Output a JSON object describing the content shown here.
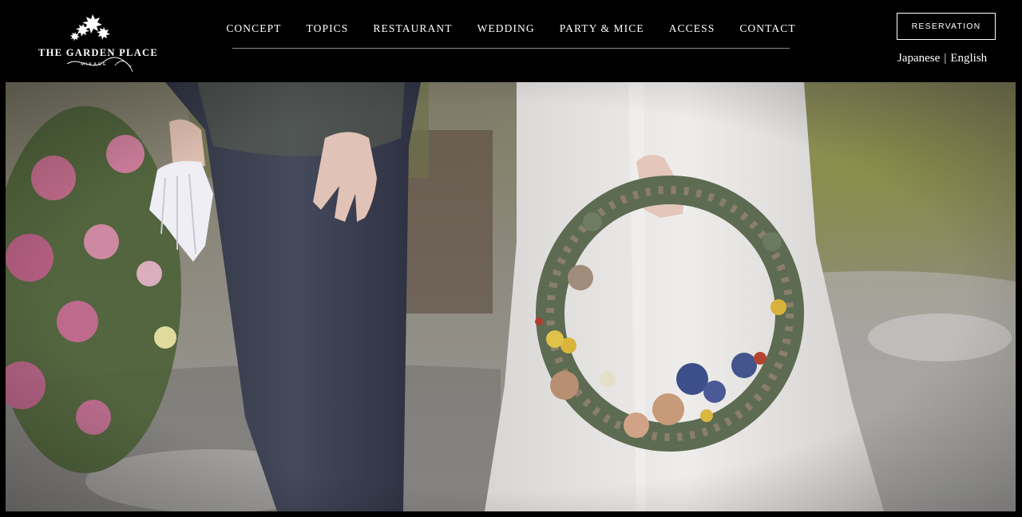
{
  "header": {
    "logo": {
      "title": "THE GARDEN PLACE",
      "script": "Soshuen",
      "subtitle": "MIKAGE",
      "icon": "maple-leaves-icon"
    },
    "nav": [
      {
        "label": "CONCEPT"
      },
      {
        "label": "TOPICS"
      },
      {
        "label": "RESTAURANT"
      },
      {
        "label": "WEDDING"
      },
      {
        "label": "PARTY & MICE"
      },
      {
        "label": "ACCESS"
      },
      {
        "label": "CONTACT"
      }
    ],
    "reservation_label": "RESERVATION",
    "languages": {
      "japanese": "Japanese",
      "separator": "|",
      "english": "English"
    }
  },
  "hero": {
    "image_alt": "wedding-couple-with-floral-wreath"
  },
  "colors": {
    "header_bg": "#000000",
    "text": "#ffffff",
    "nav_underline": "#8a8a8a"
  }
}
